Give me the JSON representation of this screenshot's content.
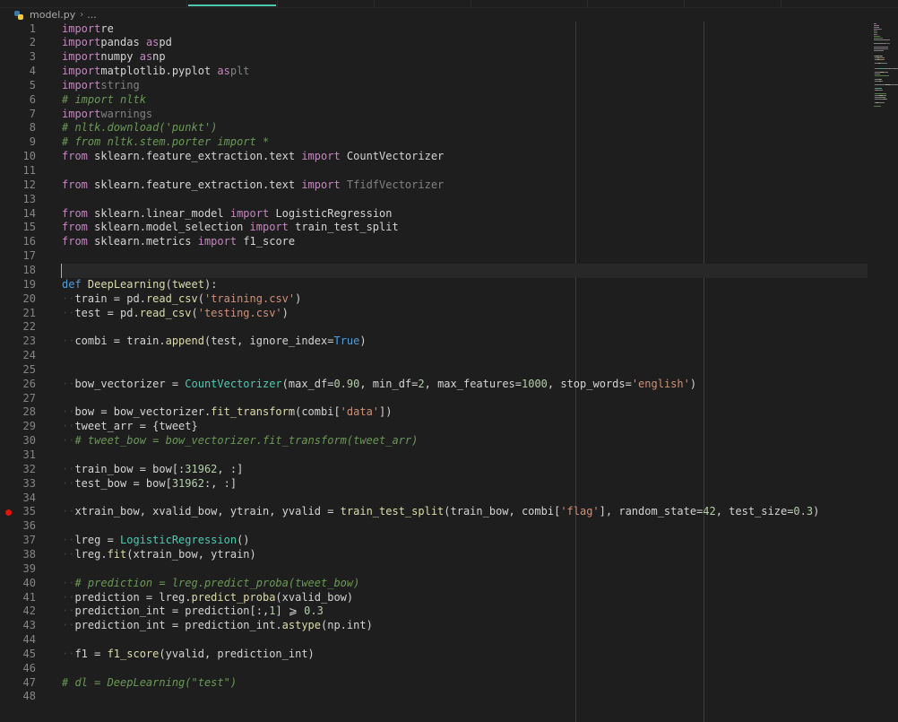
{
  "breadcrumb": {
    "file": "model.py",
    "separator": "›",
    "more": "..."
  },
  "icons": {
    "file_icon": "python-file-icon",
    "breakpoint": "breakpoint-icon"
  },
  "editor": {
    "current_line": 18,
    "breakpoint_line": 35,
    "lines": [
      [
        [
          "kw",
          "import"
        ],
        [
          "",
          "re"
        ]
      ],
      [
        [
          "kw",
          "import"
        ],
        [
          "",
          "pandas "
        ],
        [
          "kw",
          "as"
        ],
        [
          "",
          "pd"
        ]
      ],
      [
        [
          "kw",
          "import"
        ],
        [
          "",
          "numpy "
        ],
        [
          "kw",
          "as"
        ],
        [
          "",
          "np"
        ]
      ],
      [
        [
          "kw",
          "import"
        ],
        [
          "",
          "matplotlib.pyplot "
        ],
        [
          "kw",
          "as"
        ],
        [
          "dim",
          "plt"
        ]
      ],
      [
        [
          "kw",
          "import"
        ],
        [
          "dim",
          "string"
        ]
      ],
      [
        [
          "cm",
          "# import nltk"
        ]
      ],
      [
        [
          "kw",
          "import"
        ],
        [
          "dim",
          "warnings"
        ]
      ],
      [
        [
          "cm",
          "# nltk.download('punkt')"
        ]
      ],
      [
        [
          "cm",
          "# from nltk.stem.porter import *"
        ]
      ],
      [
        [
          "kw",
          "from"
        ],
        [
          "",
          " sklearn.feature_extraction.text "
        ],
        [
          "kw",
          "import"
        ],
        [
          "",
          " CountVectorizer"
        ]
      ],
      [],
      [
        [
          "kw",
          "from"
        ],
        [
          "",
          " sklearn.feature_extraction.text "
        ],
        [
          "kw",
          "import"
        ],
        [
          "dim",
          " TfidfVectorizer"
        ]
      ],
      [],
      [
        [
          "kw",
          "from"
        ],
        [
          "",
          " sklearn.linear_model "
        ],
        [
          "kw",
          "import"
        ],
        [
          "",
          " LogisticRegression"
        ]
      ],
      [
        [
          "kw",
          "from"
        ],
        [
          "",
          " sklearn.model_selection "
        ],
        [
          "kw",
          "import"
        ],
        [
          "",
          " train_test_split"
        ]
      ],
      [
        [
          "kw",
          "from"
        ],
        [
          "",
          " sklearn.metrics "
        ],
        [
          "kw",
          "import"
        ],
        [
          "",
          " f1_score"
        ]
      ],
      [],
      [],
      [
        [
          "df",
          "def"
        ],
        [
          "",
          " "
        ],
        [
          "fn",
          "DeepLearning"
        ],
        [
          "",
          "("
        ],
        [
          "fn",
          "tweet"
        ],
        [
          "",
          "):"
        ]
      ],
      [
        [
          "ind",
          "··"
        ],
        [
          "",
          "train = pd."
        ],
        [
          "fn",
          "read_csv"
        ],
        [
          "",
          "("
        ],
        [
          "str",
          "'training.csv'"
        ],
        [
          "",
          ")"
        ]
      ],
      [
        [
          "ind",
          "··"
        ],
        [
          "",
          "test = pd."
        ],
        [
          "fn",
          "read_csv"
        ],
        [
          "",
          "("
        ],
        [
          "str",
          "'testing.csv'"
        ],
        [
          "",
          ")"
        ]
      ],
      [],
      [
        [
          "ind",
          "··"
        ],
        [
          "",
          "combi = train."
        ],
        [
          "fn",
          "append"
        ],
        [
          "",
          "(test, ignore_index="
        ],
        [
          "df",
          "True"
        ],
        [
          "",
          ")"
        ]
      ],
      [],
      [],
      [
        [
          "ind",
          "··"
        ],
        [
          "",
          "bow_vectorizer = "
        ],
        [
          "cls",
          "CountVectorizer"
        ],
        [
          "",
          "(max_df="
        ],
        [
          "num",
          "0.90"
        ],
        [
          "",
          ", min_df="
        ],
        [
          "num",
          "2"
        ],
        [
          "",
          ", max_features="
        ],
        [
          "num",
          "1000"
        ],
        [
          "",
          ", stop_words="
        ],
        [
          "str",
          "'english'"
        ],
        [
          "",
          ")"
        ]
      ],
      [],
      [
        [
          "ind",
          "··"
        ],
        [
          "",
          "bow = bow_vectorizer."
        ],
        [
          "fn",
          "fit_transform"
        ],
        [
          "",
          "(combi["
        ],
        [
          "str",
          "'data'"
        ],
        [
          "",
          "])"
        ]
      ],
      [
        [
          "ind",
          "··"
        ],
        [
          "",
          "tweet_arr = {tweet}"
        ]
      ],
      [
        [
          "ind",
          "··"
        ],
        [
          "cm",
          "# tweet_bow = bow_vectorizer.fit_transform(tweet_arr)"
        ]
      ],
      [],
      [
        [
          "ind",
          "··"
        ],
        [
          "",
          "train_bow = bow[:"
        ],
        [
          "num",
          "31962"
        ],
        [
          "",
          ", :]"
        ]
      ],
      [
        [
          "ind",
          "··"
        ],
        [
          "",
          "test_bow = bow["
        ],
        [
          "num",
          "31962"
        ],
        [
          "",
          ":, :]"
        ]
      ],
      [],
      [
        [
          "ind",
          "··"
        ],
        [
          "",
          "xtrain_bow, xvalid_bow, ytrain, yvalid = "
        ],
        [
          "fn",
          "train_test_split"
        ],
        [
          "",
          "(train_bow, combi["
        ],
        [
          "str",
          "'flag'"
        ],
        [
          "",
          "], random_state="
        ],
        [
          "num",
          "42"
        ],
        [
          "",
          ", test_size="
        ],
        [
          "num",
          "0.3"
        ],
        [
          "",
          ")"
        ]
      ],
      [],
      [
        [
          "ind",
          "··"
        ],
        [
          "",
          "lreg = "
        ],
        [
          "cls",
          "LogisticRegression"
        ],
        [
          "",
          "()"
        ]
      ],
      [
        [
          "ind",
          "··"
        ],
        [
          "",
          "lreg."
        ],
        [
          "fn",
          "fit"
        ],
        [
          "",
          "(xtrain_bow, ytrain)"
        ]
      ],
      [],
      [
        [
          "ind",
          "··"
        ],
        [
          "cm",
          "# prediction = lreg.predict_proba(tweet_bow)"
        ]
      ],
      [
        [
          "ind",
          "··"
        ],
        [
          "",
          "prediction = lreg."
        ],
        [
          "fn",
          "predict_proba"
        ],
        [
          "",
          "(xvalid_bow)"
        ]
      ],
      [
        [
          "ind",
          "··"
        ],
        [
          "",
          "prediction_int = prediction[:,"
        ],
        [
          "num",
          "1"
        ],
        [
          "",
          "] ⩾ "
        ],
        [
          "num",
          "0.3"
        ]
      ],
      [
        [
          "ind",
          "··"
        ],
        [
          "",
          "prediction_int = prediction_int."
        ],
        [
          "fn",
          "astype"
        ],
        [
          "",
          "(np.int)"
        ]
      ],
      [],
      [
        [
          "ind",
          "··"
        ],
        [
          "",
          "f1 = "
        ],
        [
          "fn",
          "f1_score"
        ],
        [
          "",
          "(yvalid, prediction_int)"
        ]
      ],
      [],
      [
        [
          "cm",
          "# dl = DeepLearning(\"test\")"
        ]
      ],
      []
    ]
  }
}
